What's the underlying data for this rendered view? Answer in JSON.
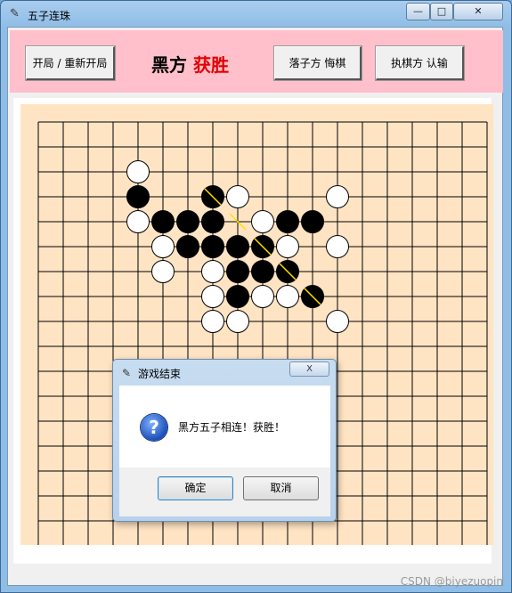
{
  "window": {
    "title": "五子连珠",
    "icon": "feather-icon",
    "controls": [
      "minimize-icon",
      "maximize-icon",
      "close-icon"
    ]
  },
  "toolbar": {
    "new_game_label": "开局 / 重新开局",
    "status_player": "黑方",
    "status_result": "获胜",
    "undo_label": "落子方 悔棋",
    "resign_label": "执棋方 认输"
  },
  "board": {
    "size": 19,
    "background": "#ffe4c4",
    "black": [
      [
        4,
        3
      ],
      [
        7,
        3
      ],
      [
        5,
        4
      ],
      [
        6,
        4
      ],
      [
        7,
        4
      ],
      [
        10,
        4
      ],
      [
        11,
        4
      ],
      [
        6,
        5
      ],
      [
        7,
        5
      ],
      [
        8,
        5
      ],
      [
        9,
        5
      ],
      [
        8,
        6
      ],
      [
        9,
        6
      ],
      [
        10,
        6
      ],
      [
        8,
        7
      ],
      [
        11,
        7
      ]
    ],
    "white": [
      [
        4,
        2
      ],
      [
        8,
        3
      ],
      [
        12,
        3
      ],
      [
        4,
        4
      ],
      [
        9,
        4
      ],
      [
        5,
        5
      ],
      [
        10,
        5
      ],
      [
        12,
        5
      ],
      [
        5,
        6
      ],
      [
        7,
        6
      ],
      [
        7,
        7
      ],
      [
        9,
        7
      ],
      [
        10,
        7
      ],
      [
        7,
        8
      ],
      [
        8,
        8
      ],
      [
        12,
        8
      ]
    ],
    "winning_line": [
      [
        7,
        3
      ],
      [
        8,
        4
      ],
      [
        9,
        5
      ],
      [
        10,
        6
      ],
      [
        11,
        7
      ]
    ]
  },
  "dialog": {
    "title": "游戏结束",
    "icon": "question-icon",
    "message": "黑方五子相连！获胜！",
    "ok_label": "确定",
    "cancel_label": "取消",
    "close_label": "X"
  },
  "watermark": "CSDN @biyezuopin"
}
